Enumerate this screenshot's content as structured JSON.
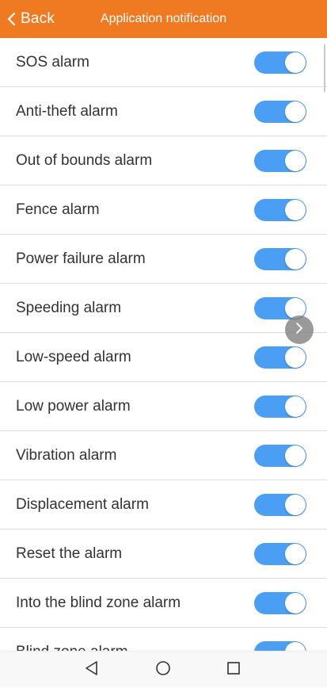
{
  "header": {
    "back_label": "Back",
    "title": "Application notification",
    "background_color": "#EF7A22"
  },
  "list": {
    "toggle_color": "#4A9EF3",
    "items": [
      {
        "label": "SOS alarm",
        "enabled": true
      },
      {
        "label": "Anti-theft alarm",
        "enabled": true
      },
      {
        "label": "Out of bounds alarm",
        "enabled": true
      },
      {
        "label": "Fence alarm",
        "enabled": true
      },
      {
        "label": "Power failure alarm",
        "enabled": true
      },
      {
        "label": "Speeding alarm",
        "enabled": true
      },
      {
        "label": "Low-speed alarm",
        "enabled": true
      },
      {
        "label": "Low power alarm",
        "enabled": true
      },
      {
        "label": "Vibration alarm",
        "enabled": true
      },
      {
        "label": "Displacement alarm",
        "enabled": true
      },
      {
        "label": "Reset the alarm",
        "enabled": true
      },
      {
        "label": "Into the blind zone alarm",
        "enabled": true
      },
      {
        "label": "Blind zone alarm",
        "enabled": true
      }
    ]
  },
  "icons": {
    "back": "chevron-left-icon",
    "floating": "chevron-right-icon",
    "nav_back": "triangle-back-icon",
    "nav_home": "circle-home-icon",
    "nav_recents": "square-recents-icon"
  }
}
